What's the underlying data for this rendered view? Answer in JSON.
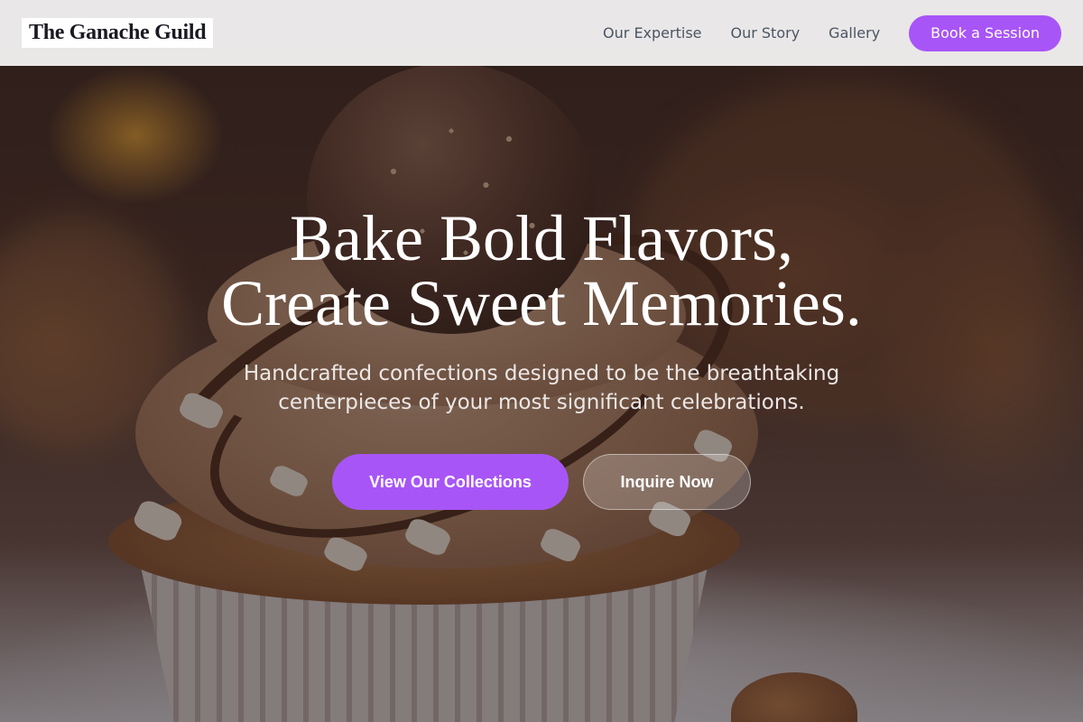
{
  "header": {
    "brand": "The Ganache Guild",
    "nav": [
      {
        "label": "Our Expertise"
      },
      {
        "label": "Our Story"
      },
      {
        "label": "Gallery"
      }
    ],
    "cta_label": "Book a Session"
  },
  "hero": {
    "headline_line1": "Bake Bold Flavors,",
    "headline_line2": "Create Sweet Memories.",
    "subheadline": "Handcrafted confections designed to be the breathtaking centerpieces of your most significant celebrations.",
    "primary_button": "View Our Collections",
    "secondary_button": "Inquire Now",
    "background_image": "chocolate-hazelnut-cupcake-photo"
  },
  "colors": {
    "accent": "#a855f7",
    "nav_text": "#4b5563",
    "header_bg": "#f5f4f4"
  }
}
